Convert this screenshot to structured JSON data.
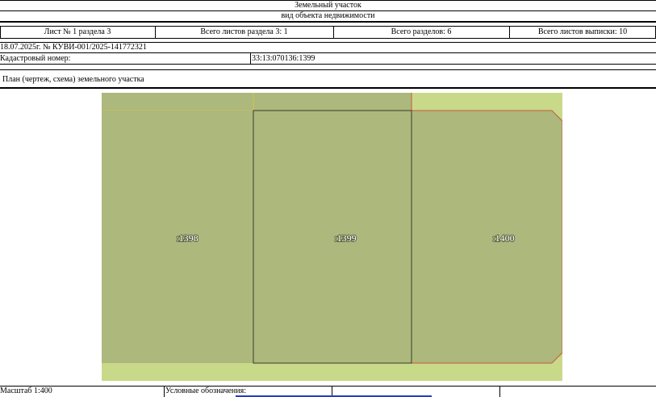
{
  "header": {
    "object_type": "Земельный участок",
    "object_kind": "вид объекта недвижимости"
  },
  "sheet_info": {
    "sheet_number": "Лист № 1 раздела 3",
    "total_sheets_section": "Всего листов раздела 3: 1",
    "total_sections": "Всего разделов: 6",
    "total_sheets_extract": "Всего листов выписки: 10"
  },
  "doc_ref": "18.07.2025г. № КУВИ-001/2025-141772321",
  "cadastral": {
    "label": "Кадастровый номер:",
    "value": "33:13:070136:1399"
  },
  "plan": {
    "title": "План (чертеж, схема) земельного участка",
    "parcels": [
      ":1398",
      ":1399",
      ":1400"
    ],
    "colors": {
      "background": "#c8d98a",
      "parcel_fill": "#adb87c",
      "parcel_border": "#3a3a2a",
      "neighbor_border": "#c85a3a"
    }
  },
  "footer": {
    "scale": "Масштаб 1:400",
    "legend_label": "Условные обозначения:"
  }
}
